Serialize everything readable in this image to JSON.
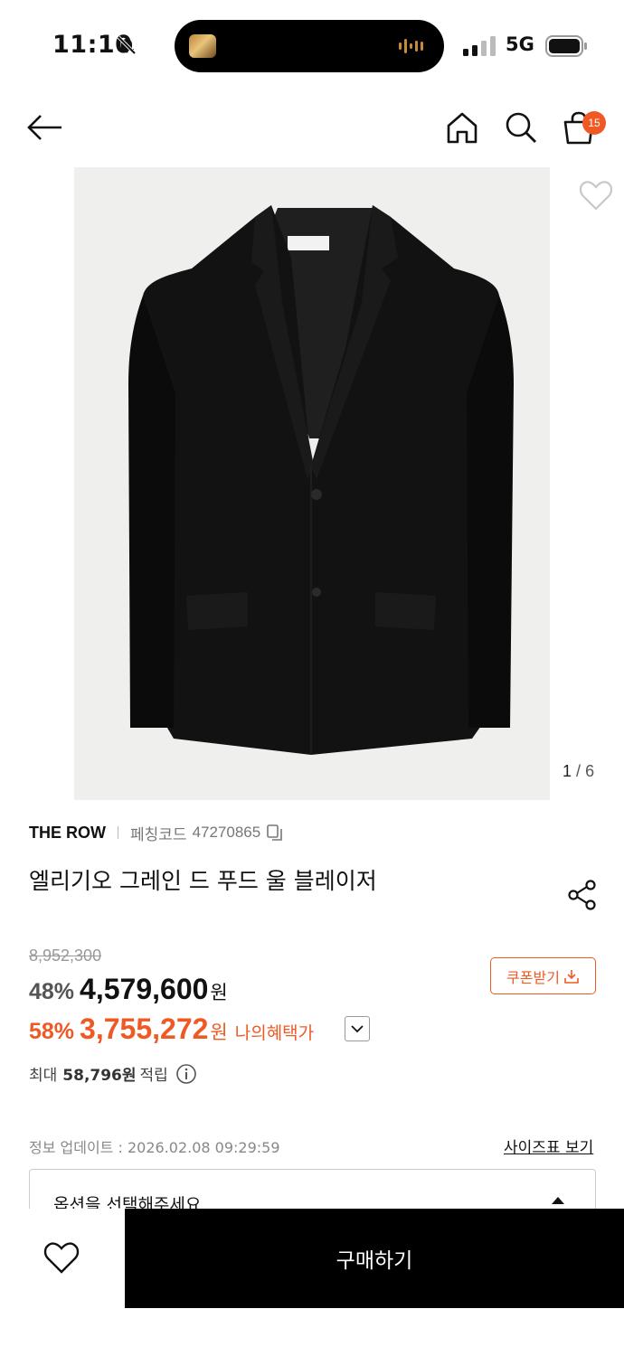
{
  "status_bar": {
    "time": "11:10",
    "network": "5G"
  },
  "header": {
    "cart_count": "15",
    "icons": [
      "back-arrow-icon",
      "home-icon",
      "search-icon",
      "shopping-bag-icon"
    ]
  },
  "gallery": {
    "current": "1",
    "separator": "/",
    "total": "6"
  },
  "product": {
    "brand": "THE ROW",
    "code_label": "페칭코드",
    "code_value": "47270865",
    "name": "엘리기오 그레인 드 푸드 울 블레이저"
  },
  "pricing": {
    "original_price": "8,952,300",
    "discount_rate": "48%",
    "sale_price": "4,579,600",
    "currency": "원",
    "benefit_rate": "58%",
    "benefit_price": "3,755,272",
    "benefit_label": "나의혜택가",
    "coupon_label": "쿠폰받기",
    "points_label": "최대",
    "points_value": "58,796원",
    "points_suffix": "적립"
  },
  "info": {
    "update_text": "정보 업데이트 : 2026.02.08 09:29:59",
    "size_chart_label": "사이즈표 보기"
  },
  "option": {
    "placeholder": "옵션을 선택해주세요"
  },
  "bottom": {
    "buy_label": "구매하기"
  },
  "colors": {
    "accent": "#ef5a24",
    "primary": "#000000",
    "image_bg": "#efefed"
  }
}
